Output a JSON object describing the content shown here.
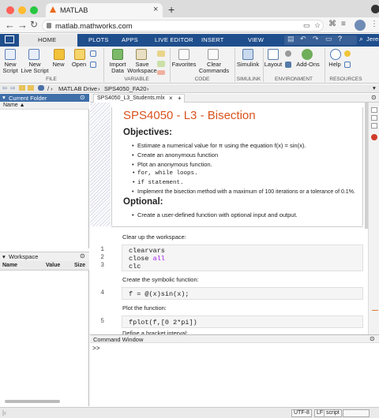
{
  "browser": {
    "tab_title": "MATLAB",
    "url": "matlab.mathworks.com",
    "user": "Jeremy"
  },
  "matlab_tabs": [
    "HOME",
    "PLOTS",
    "APPS",
    "LIVE EDITOR",
    "INSERT",
    "VIEW"
  ],
  "ribbon": {
    "buttons": [
      {
        "label": "New\nScript",
        "icon": "new-script-icon"
      },
      {
        "label": "New\nLive Script",
        "icon": "new-live-script-icon"
      },
      {
        "label": "New",
        "icon": "new-icon"
      },
      {
        "label": "Open",
        "icon": "open-icon"
      },
      {
        "label": "Import\nData",
        "icon": "import-data-icon"
      },
      {
        "label": "Save\nWorkspace",
        "icon": "save-workspace-icon"
      },
      {
        "label": "Favorites",
        "icon": "favorites-icon"
      },
      {
        "label": "Clear\nCommands",
        "icon": "clear-commands-icon"
      },
      {
        "label": "Simulink",
        "icon": "simulink-icon"
      },
      {
        "label": "Layout",
        "icon": "layout-icon"
      },
      {
        "label": "Add-Ons",
        "icon": "addons-icon"
      },
      {
        "label": "Help",
        "icon": "help-icon"
      }
    ],
    "groups": [
      "FILE",
      "VARIABLE",
      "CODE",
      "SIMULINK",
      "ENVIRONMENT",
      "RESOURCES"
    ]
  },
  "path": {
    "drive": "MATLAB Drive",
    "folder": "SPS4050_FA20"
  },
  "current_folder": {
    "title": "Current Folder",
    "name_col": "Name ▲"
  },
  "workspace": {
    "title": "Workspace",
    "cols": [
      "Name",
      "Value",
      "Size"
    ]
  },
  "editor": {
    "tab_name": "SPS4050_L3_Students.mlx",
    "title": "SPS4050 - L3 - Bisection",
    "objectives_heading": "Objectives:",
    "objectives": [
      "Estimate a numerical value for π using the equation  f(x) = sin(x).",
      "Create an anonymous function",
      "Plot an anonymous function.",
      "for, while loops.",
      "if statement.",
      "Implement the bisection method with a maximum of 100 iterations or a tolerance of 0.1%."
    ],
    "optional_heading": "Optional:",
    "optional": [
      "Create a user-defined function with optional input and output."
    ],
    "sections": [
      {
        "text": "Clear up the workspace:"
      },
      {
        "text": "Create the symbolic function:"
      },
      {
        "text": "Plot the function:"
      }
    ],
    "code": [
      {
        "ln": "1",
        "code": "clearvars"
      },
      {
        "ln": "2",
        "code": "close all"
      },
      {
        "ln": "3",
        "code": "clc"
      },
      {
        "ln": "4",
        "code": "f = @(x)sin(x);"
      },
      {
        "ln": "5",
        "code": "fplot(f,[0 2*pi])"
      }
    ],
    "cut_text": "Define a bracket interval:"
  },
  "command_window": {
    "title": "Command Window",
    "prompt": ">>"
  },
  "status": {
    "encoding": "UTF-8",
    "eol": "LF",
    "type": "script"
  }
}
